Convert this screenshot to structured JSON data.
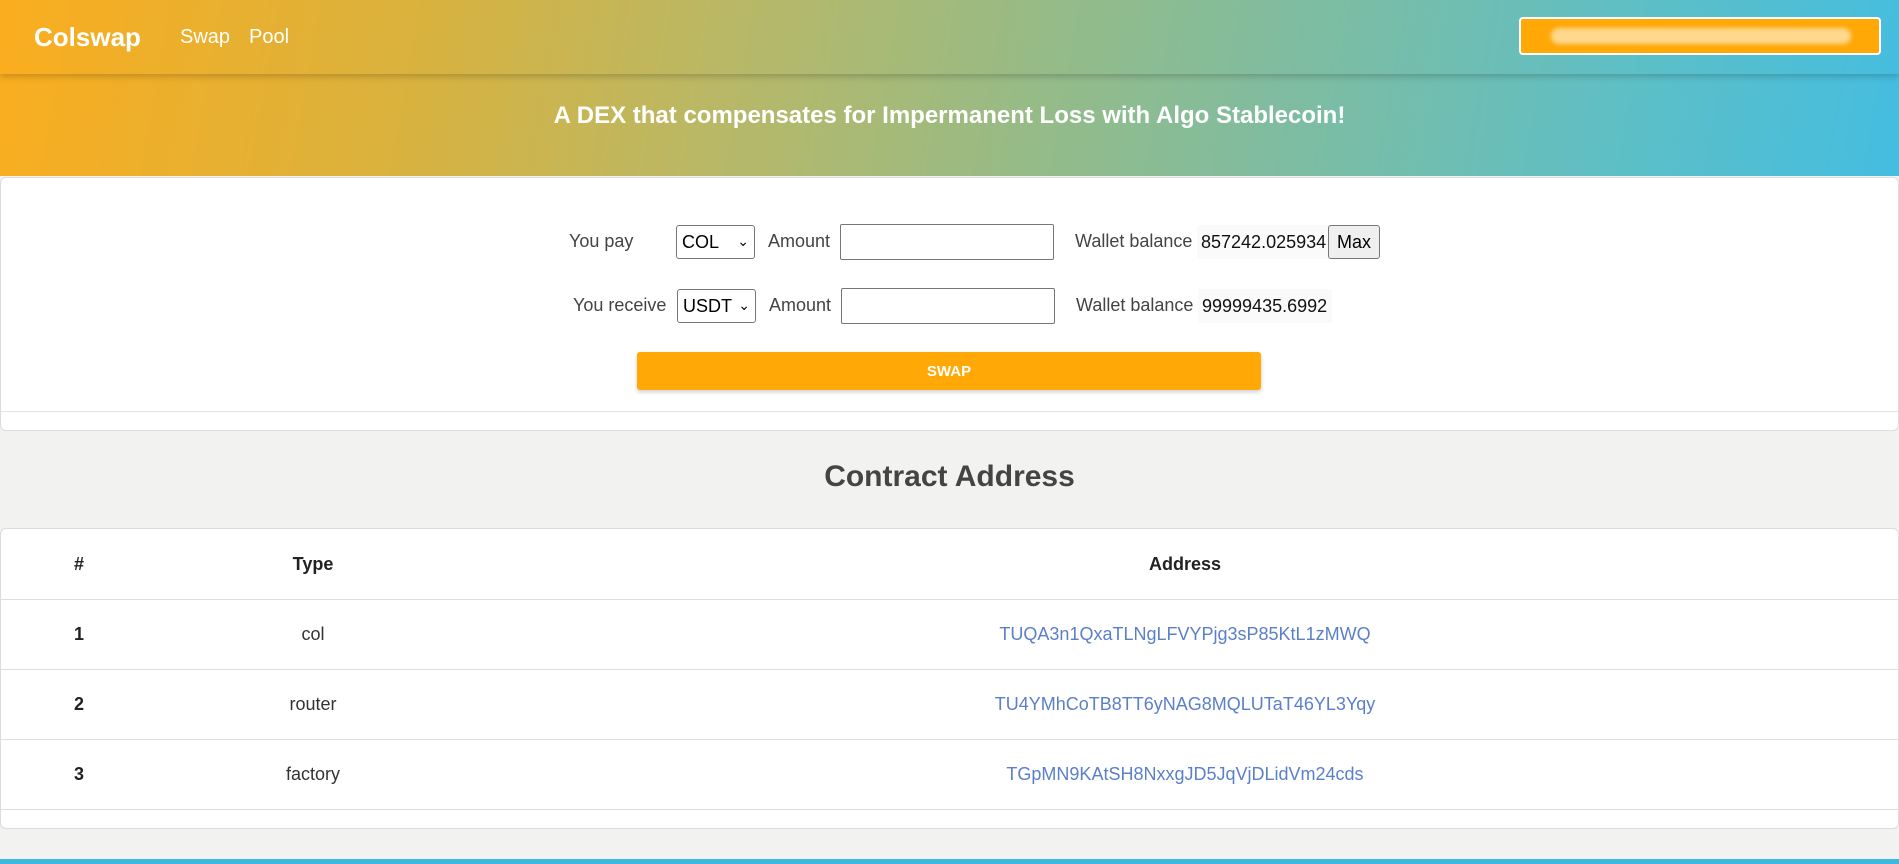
{
  "header": {
    "brand": "Colswap",
    "nav": [
      "Swap",
      "Pool"
    ],
    "wallet_button": "(OBSCURED)",
    "tagline": "A DEX that compensates for Impermanent Loss with Algo Stablecoin!"
  },
  "swap": {
    "pay": {
      "label": "You pay",
      "token": "COL",
      "amount_label": "Amount",
      "amount_value": "",
      "balance_label": "Wallet balance",
      "balance_value": "857242.025934"
    },
    "receive": {
      "label": "You receive",
      "token": "USDT",
      "amount_label": "Amount",
      "amount_value": "",
      "balance_label": "Wallet balance",
      "balance_value": "99999435.6992"
    },
    "max_label": "Max",
    "swap_label": "SWAP"
  },
  "contracts": {
    "title": "Contract Address",
    "headers": [
      "#",
      "Type",
      "Address"
    ],
    "rows": [
      {
        "num": "1",
        "type": "col",
        "address": "TUQA3n1QxaTLNgLFVYPjg3sP85KtL1zMWQ"
      },
      {
        "num": "2",
        "type": "router",
        "address": "TU4YMhCoTB8TT6yNAG8MQLUTaT46YL3Yqy"
      },
      {
        "num": "3",
        "type": "factory",
        "address": "TGpMN9KAtSH8NxxgJD5JqVjDLidVm24cds"
      }
    ]
  },
  "colors": {
    "accent": "#ffa806",
    "link": "#5b7fc9",
    "gradient_start": "#fbad1e",
    "gradient_end": "#44bde0"
  }
}
